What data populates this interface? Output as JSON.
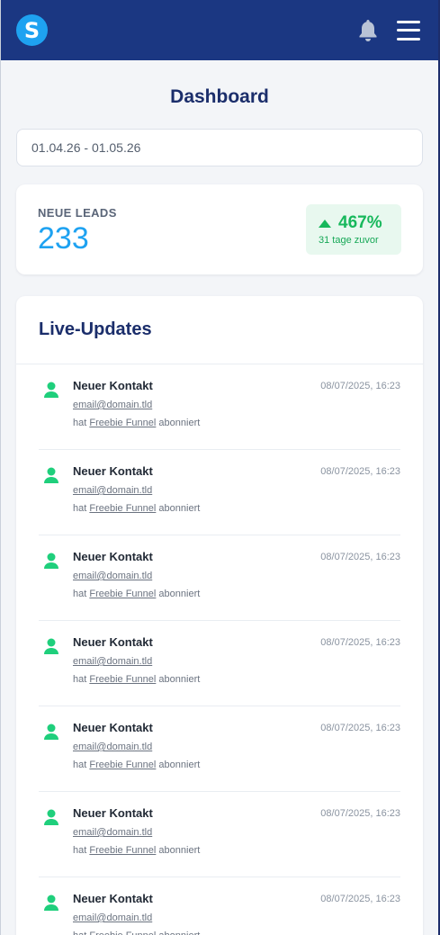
{
  "header": {
    "logo_letter": "S",
    "icons": [
      "bell-icon",
      "menu-icon"
    ]
  },
  "page": {
    "title": "Dashboard",
    "date_range": "01.04.26 - 01.05.26"
  },
  "leads": {
    "label": "NEUE LEADS",
    "value": "233",
    "growth_pct": "467%",
    "growth_note": "31 tage zuvor"
  },
  "updates": {
    "title": "Live-Updates",
    "items": [
      {
        "title": "Neuer Kontakt",
        "email": "email@domain.tld",
        "prefix": "hat",
        "funnel": "Freebie Funnel",
        "suffix": "abonniert",
        "time": "08/07/2025, 16:23"
      },
      {
        "title": "Neuer Kontakt",
        "email": "email@domain.tld",
        "prefix": "hat",
        "funnel": "Freebie Funnel",
        "suffix": "abonniert",
        "time": "08/07/2025, 16:23"
      },
      {
        "title": "Neuer Kontakt",
        "email": "email@domain.tld",
        "prefix": "hat",
        "funnel": "Freebie Funnel",
        "suffix": "abonniert",
        "time": "08/07/2025, 16:23"
      },
      {
        "title": "Neuer Kontakt",
        "email": "email@domain.tld",
        "prefix": "hat",
        "funnel": "Freebie Funnel",
        "suffix": "abonniert",
        "time": "08/07/2025, 16:23"
      },
      {
        "title": "Neuer Kontakt",
        "email": "email@domain.tld",
        "prefix": "hat",
        "funnel": "Freebie Funnel",
        "suffix": "abonniert",
        "time": "08/07/2025, 16:23"
      },
      {
        "title": "Neuer Kontakt",
        "email": "email@domain.tld",
        "prefix": "hat",
        "funnel": "Freebie Funnel",
        "suffix": "abonniert",
        "time": "08/07/2025, 16:23"
      },
      {
        "title": "Neuer Kontakt",
        "email": "email@domain.tld",
        "prefix": "hat",
        "funnel": "Freebie Funnel",
        "suffix": "abonniert",
        "time": "08/07/2025, 16:23"
      }
    ]
  },
  "colors": {
    "header_bg": "#1b3782",
    "accent_blue": "#1ea2f1",
    "success_green": "#17b85c"
  }
}
